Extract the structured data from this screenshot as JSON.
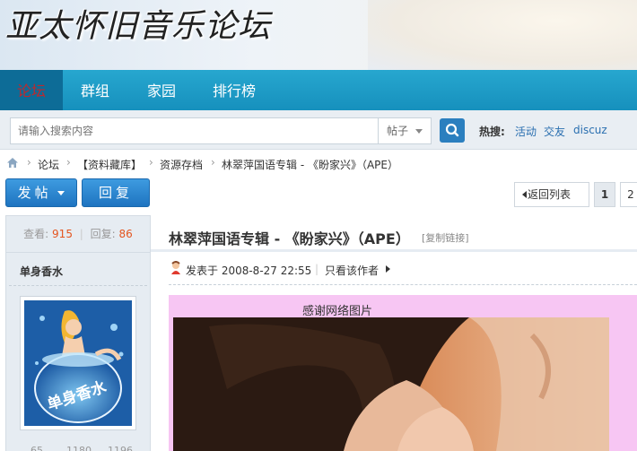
{
  "header": {
    "site_title": "亚太怀旧音乐论坛"
  },
  "nav": {
    "items": [
      {
        "label": "论坛",
        "active": true
      },
      {
        "label": "群组",
        "active": false
      },
      {
        "label": "家园",
        "active": false
      },
      {
        "label": "排行榜",
        "active": false
      }
    ]
  },
  "search": {
    "placeholder": "请输入搜索内容",
    "type_selected": "帖子",
    "hot_label": "热搜:",
    "hot_links": [
      "活动",
      "交友",
      "discuz"
    ]
  },
  "breadcrumb": {
    "items": [
      "论坛",
      "【资料藏库】",
      "资源存档",
      "林翠萍国语专辑 - 《盼家兴》（APE）"
    ]
  },
  "actions": {
    "post_label": "发帖",
    "reply_label": "回复",
    "back_label": "返回列表",
    "pages": [
      "1",
      "2"
    ]
  },
  "thread": {
    "views_label": "查看:",
    "views": "915",
    "replies_label": "回复:",
    "replies": "86",
    "title": "林翠萍国语专辑 - 《盼家兴》（APE）",
    "copy_link": "[复制链接]"
  },
  "author": {
    "name": "单身香水",
    "avatar_text": "单身香水",
    "stats": [
      "65",
      "1180",
      "1196"
    ]
  },
  "post": {
    "posted_at": "发表于 2008-8-27 22:55",
    "only_author": "只看该作者",
    "caption": "感谢网络图片"
  },
  "colors": {
    "nav": "#1690bd",
    "nav_active": "#0d6c97",
    "accent_num": "#e4551f",
    "post_bg": "#f7c6f3"
  }
}
